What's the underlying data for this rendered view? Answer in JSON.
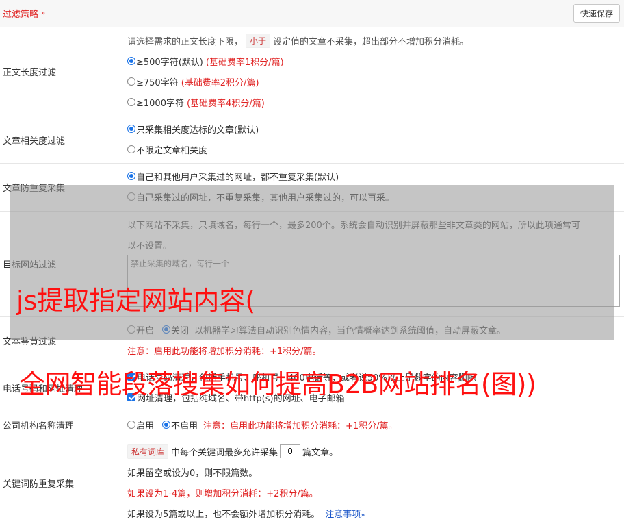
{
  "header": {
    "title": "过滤策略",
    "chevron": "»",
    "save_label": "快速保存"
  },
  "length": {
    "label": "正文长度过滤",
    "desc_pre": "请选择需求的正文长度下限，",
    "desc_tag": "小于",
    "desc_post": "设定值的文章不采集，超出部分不增加积分消耗。",
    "options": [
      {
        "label": "≥500字符(默认)",
        "note": "(基础费率1积分/篇)",
        "selected": true
      },
      {
        "label": "≥750字符",
        "note": "(基础费率2积分/篇)",
        "selected": false
      },
      {
        "label": "≥1000字符",
        "note": "(基础费率4积分/篇)",
        "selected": false
      }
    ]
  },
  "relevance": {
    "label": "文章相关度过滤",
    "options": [
      {
        "label": "只采集相关度达标的文章(默认)",
        "selected": true
      },
      {
        "label": "不限定文章相关度",
        "selected": false
      }
    ]
  },
  "dedupe": {
    "label": "文章防重复采集",
    "options": [
      {
        "label": "自己和其他用户采集过的网址，都不重复采集(默认)",
        "selected": true
      },
      {
        "label": "自己采集过的网址，不重复采集，其他用户采集过的，可以再采。",
        "selected": false
      }
    ]
  },
  "site_filter": {
    "label": "目标网站过滤",
    "desc1": "以下网站不采集，只填域名，每行一个，最多200个。系统会自动识别并屏蔽那些非文章类的网站，所以此项通常可",
    "desc2": "以不设置。",
    "placeholder": "禁止采集的域名，每行一个"
  },
  "porn_filter": {
    "label": "文本鉴黄过滤",
    "opt_on": "开启",
    "opt_off": "关闭",
    "desc": "以机器学习算法自动识别色情内容，当色情概率达到系统阈值，自动屏蔽文章。",
    "note": "注意：启用此功能将增加积分消耗：+1积分/篇。"
  },
  "contact_clean": {
    "label": "电话号码和网址清理",
    "line1": "电话号码清理，包括手机号、座机号、400电话等，或者说50%以上是数字的内容删除",
    "line2": "网址清理，包括纯域名、带http(s)的网址、电子邮箱"
  },
  "org_clean": {
    "label": "公司机构名称清理",
    "opt_on": "启用",
    "opt_off": "不启用",
    "note": "注意：启用此功能将增加积分消耗：+1积分/篇。"
  },
  "keyword_dedupe": {
    "label": "关键词防重复采集",
    "tag": "私有词库",
    "line1_mid": "中每个关键词最多允许采集",
    "value": "0",
    "line1_post": "篇文章。",
    "line2": "如果留空或设为0，则不限篇数。",
    "line3": "如果设为1-4篇，则增加积分消耗：+2积分/篇。",
    "line4": "如果设为5篇或以上，也不会额外增加积分消耗。",
    "link": "注意事项"
  },
  "watermark": {
    "line1": "js提取指定网站内容(",
    "line2": "全网智能段落搜集如何提高B2B网站排名(图))"
  }
}
